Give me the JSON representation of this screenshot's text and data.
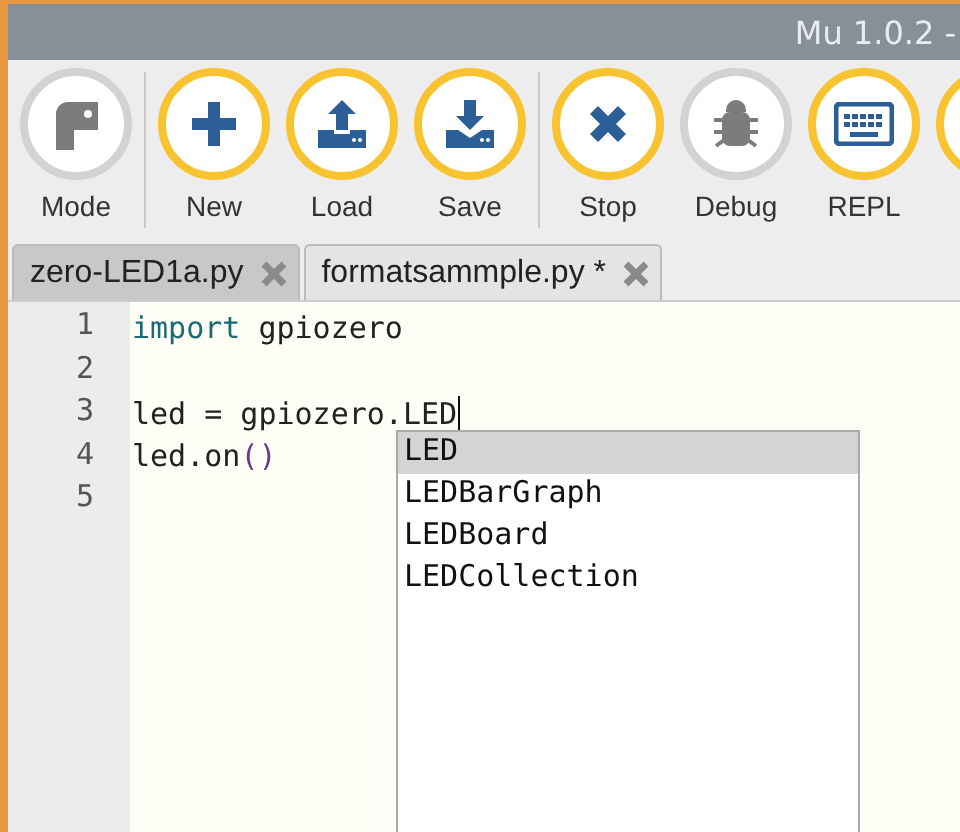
{
  "window": {
    "title": "Mu 1.0.2 -"
  },
  "toolbar": [
    {
      "kind": "button",
      "label": "Mode",
      "enabled": false
    },
    {
      "kind": "separator"
    },
    {
      "kind": "button",
      "label": "New",
      "enabled": true
    },
    {
      "kind": "button",
      "label": "Load",
      "enabled": true
    },
    {
      "kind": "button",
      "label": "Save",
      "enabled": true
    },
    {
      "kind": "separator"
    },
    {
      "kind": "button",
      "label": "Stop",
      "enabled": true
    },
    {
      "kind": "button",
      "label": "Debug",
      "enabled": false
    },
    {
      "kind": "button",
      "label": "REPL",
      "enabled": true
    },
    {
      "kind": "button",
      "enabled": true
    }
  ],
  "tabs": [
    {
      "label": "zero-LED1a.py",
      "selected": false
    },
    {
      "label": "formatsammple.py *",
      "selected": true
    }
  ],
  "editor": {
    "lines": [
      {
        "number": "1",
        "tokens": [
          {
            "text": "import",
            "kind": "keyword"
          },
          {
            "text": " gpiozero",
            "kind": "plain"
          }
        ]
      },
      {
        "number": "2"
      },
      {
        "number": "3",
        "tokens": [
          {
            "text": "led = gpiozero.LED",
            "kind": "plain"
          }
        ],
        "cursor": true
      },
      {
        "number": "4",
        "tokens": [
          {
            "text": "led.on",
            "kind": "plain"
          },
          {
            "text": "()",
            "kind": "paren"
          }
        ]
      },
      {
        "number": "5"
      }
    ],
    "autocomplete": [
      {
        "label": "LED",
        "selected": true
      },
      {
        "label": "LEDBarGraph",
        "selected": false
      },
      {
        "label": "LEDBoard",
        "selected": false
      },
      {
        "label": "LEDCollection",
        "selected": false
      }
    ]
  }
}
